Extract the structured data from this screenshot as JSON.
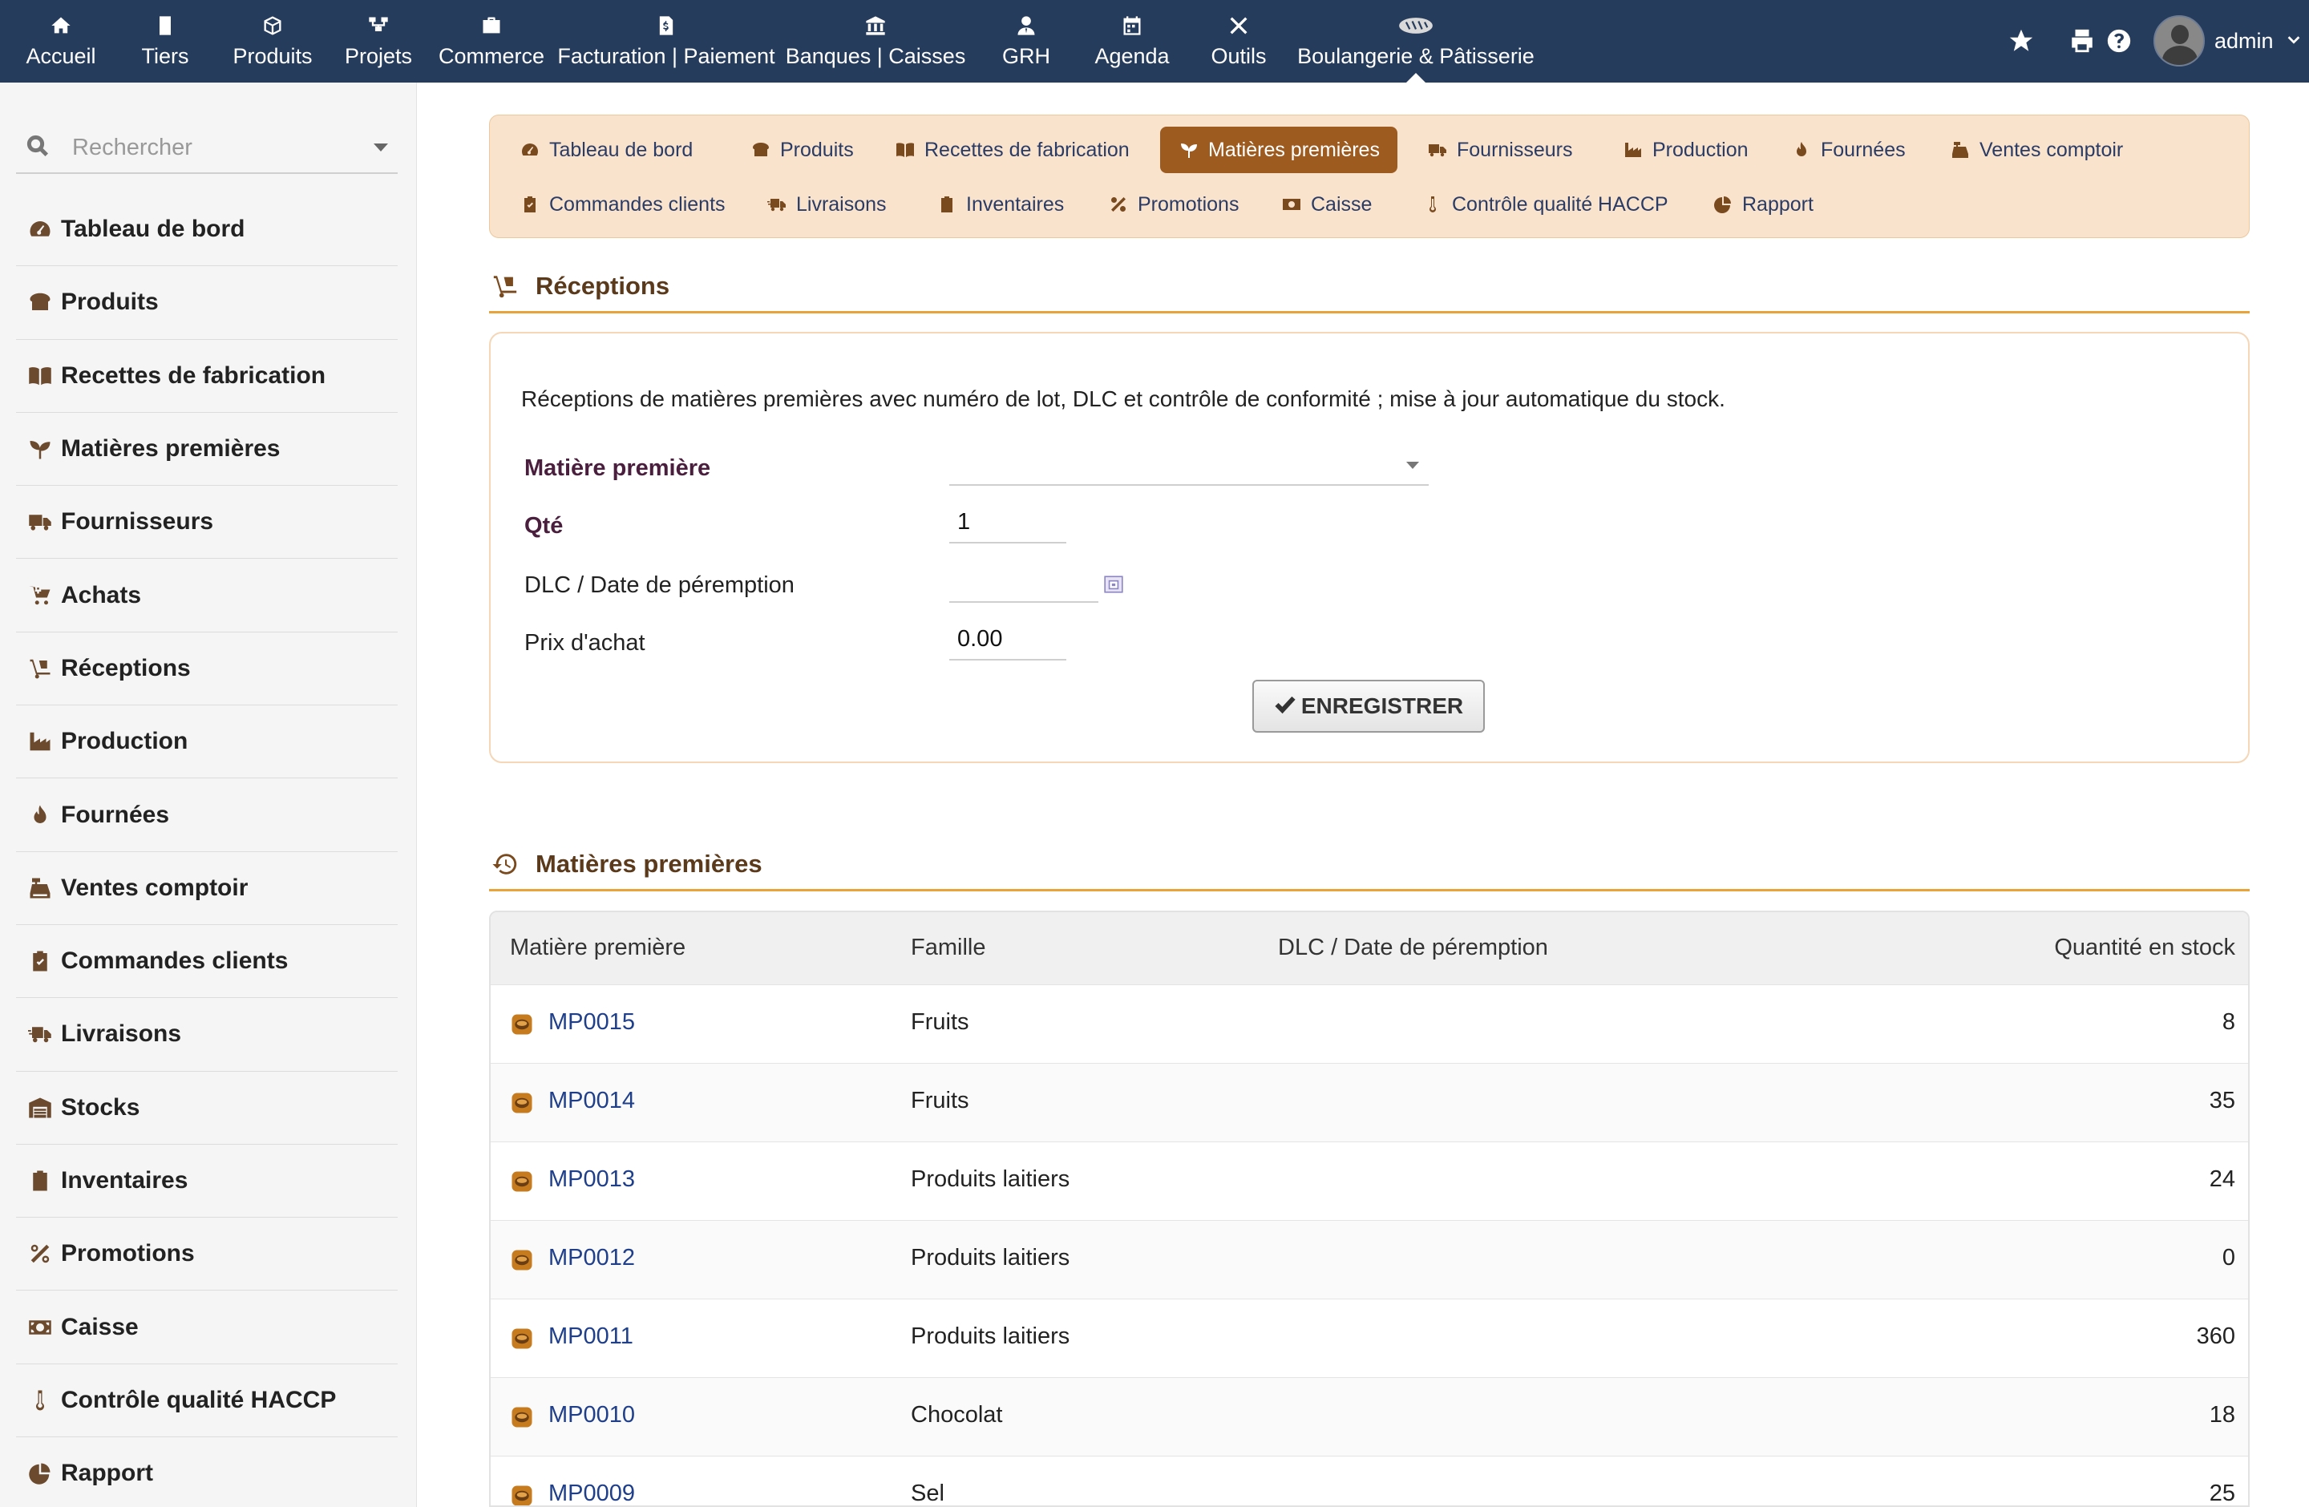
{
  "topnav": {
    "items": [
      {
        "label": "Accueil",
        "icon": "home-icon"
      },
      {
        "label": "Tiers",
        "icon": "building-icon"
      },
      {
        "label": "Produits",
        "icon": "cube-icon"
      },
      {
        "label": "Projets",
        "icon": "sitemap-icon"
      },
      {
        "label": "Commerce",
        "icon": "briefcase-icon"
      },
      {
        "label": "Facturation | Paiement",
        "icon": "invoice-icon"
      },
      {
        "label": "Banques | Caisses",
        "icon": "bank-icon"
      },
      {
        "label": "GRH",
        "icon": "user-tie-icon"
      },
      {
        "label": "Agenda",
        "icon": "calendar-icon"
      },
      {
        "label": "Outils",
        "icon": "tools-icon"
      },
      {
        "label": "Boulangerie & Pâtisserie",
        "icon": "bread-icon",
        "active": true
      }
    ],
    "username": "admin"
  },
  "sidebar": {
    "search_placeholder": "Rechercher",
    "items": [
      {
        "label": "Tableau de bord",
        "icon": "dashboard-icon"
      },
      {
        "label": "Produits",
        "icon": "bread-icon"
      },
      {
        "label": "Recettes de fabrication",
        "icon": "book-icon"
      },
      {
        "label": "Matières premières",
        "icon": "seedling-icon"
      },
      {
        "label": "Fournisseurs",
        "icon": "truck-icon"
      },
      {
        "label": "Achats",
        "icon": "cart-plus-icon"
      },
      {
        "label": "Réceptions",
        "icon": "dolly-icon"
      },
      {
        "label": "Production",
        "icon": "industry-icon"
      },
      {
        "label": "Fournées",
        "icon": "fire-icon"
      },
      {
        "label": "Ventes comptoir",
        "icon": "cash-register-icon"
      },
      {
        "label": "Commandes clients",
        "icon": "clipboard-check-icon"
      },
      {
        "label": "Livraisons",
        "icon": "shipping-fast-icon"
      },
      {
        "label": "Stocks",
        "icon": "warehouse-icon"
      },
      {
        "label": "Inventaires",
        "icon": "clipboard-list-icon"
      },
      {
        "label": "Promotions",
        "icon": "percent-icon"
      },
      {
        "label": "Caisse",
        "icon": "money-bill-icon"
      },
      {
        "label": "Contrôle qualité HACCP",
        "icon": "thermometer-icon"
      },
      {
        "label": "Rapport",
        "icon": "chart-pie-icon"
      }
    ]
  },
  "module_tabs": [
    {
      "label": "Tableau de bord",
      "icon": "dashboard-icon"
    },
    {
      "label": "Produits",
      "icon": "bread-icon"
    },
    {
      "label": "Recettes de fabrication",
      "icon": "book-icon"
    },
    {
      "label": "Matières premières",
      "icon": "seedling-icon",
      "active": true
    },
    {
      "label": "Fournisseurs",
      "icon": "truck-icon"
    },
    {
      "label": "Production",
      "icon": "industry-icon"
    },
    {
      "label": "Fournées",
      "icon": "fire-icon"
    },
    {
      "label": "Ventes comptoir",
      "icon": "cash-register-icon"
    },
    {
      "label": "Commandes clients",
      "icon": "clipboard-check-icon"
    },
    {
      "label": "Livraisons",
      "icon": "shipping-fast-icon"
    },
    {
      "label": "Inventaires",
      "icon": "clipboard-list-icon"
    },
    {
      "label": "Promotions",
      "icon": "percent-icon"
    },
    {
      "label": "Caisse",
      "icon": "money-bill-icon"
    },
    {
      "label": "Contrôle qualité HACCP",
      "icon": "thermometer-icon"
    },
    {
      "label": "Rapport",
      "icon": "chart-pie-icon"
    }
  ],
  "receptions": {
    "title": "Réceptions",
    "description": "Réceptions de matières premières avec numéro de lot, DLC et contrôle de conformité ; mise à jour automatique du stock.",
    "fields": {
      "matiere_label": "Matière première",
      "matiere_value": "",
      "qty_label": "Qté",
      "qty_value": "1",
      "dlc_label": "DLC / Date de péremption",
      "dlc_value": "",
      "price_label": "Prix d'achat",
      "price_value": "0.00"
    },
    "save_label": "ENREGISTRER"
  },
  "stock_table": {
    "title": "Matières premières",
    "headers": [
      "Matière première",
      "Famille",
      "DLC / Date de péremption",
      "Quantité en stock"
    ],
    "rows": [
      {
        "ref": "MP0015",
        "family": "Fruits",
        "dlc": "",
        "qty": "8"
      },
      {
        "ref": "MP0014",
        "family": "Fruits",
        "dlc": "",
        "qty": "35"
      },
      {
        "ref": "MP0013",
        "family": "Produits laitiers",
        "dlc": "",
        "qty": "24"
      },
      {
        "ref": "MP0012",
        "family": "Produits laitiers",
        "dlc": "",
        "qty": "0"
      },
      {
        "ref": "MP0011",
        "family": "Produits laitiers",
        "dlc": "",
        "qty": "360"
      },
      {
        "ref": "MP0010",
        "family": "Chocolat",
        "dlc": "",
        "qty": "18"
      },
      {
        "ref": "MP0009",
        "family": "Sel",
        "dlc": "",
        "qty": "25"
      }
    ]
  },
  "colors": {
    "topbar": "#263c5c",
    "accent": "#e8a33b",
    "tab_bg": "#f9e3cd",
    "tab_active": "#9e5b20",
    "link": "#1f3f8a"
  }
}
